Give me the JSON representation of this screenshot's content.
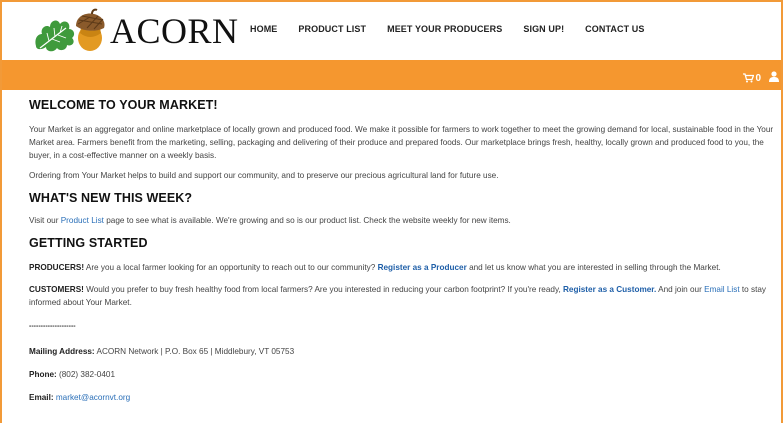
{
  "header": {
    "logo_text": "ACORN",
    "nav": [
      "HOME",
      "PRODUCT LIST",
      "MEET YOUR PRODUCERS",
      "SIGN UP!",
      "CONTACT US"
    ]
  },
  "toolbar": {
    "cart_count": "0",
    "cart_icon": "cart-icon",
    "user_icon": "user-icon"
  },
  "main": {
    "welcome_heading": "WELCOME TO YOUR MARKET!",
    "welcome_p1": "Your Market is an aggregator and online marketplace of locally grown and produced food. We make it possible for farmers to work together to meet the growing demand for local, sustainable food in the Your Market area. Farmers benefit from the marketing, selling, packaging and delivering of their produce and prepared foods. Our marketplace brings fresh, healthy, locally grown and produced food to you, the buyer, in a cost-effective manner on a weekly basis.",
    "welcome_p2": "Ordering from Your Market helps to build and support our community, and to preserve our precious agricultural land for future use.",
    "new_heading": "WHAT'S NEW THIS WEEK?",
    "new_pre": "Visit our ",
    "new_link": "Product List",
    "new_post": " page to see what is available. We're growing and so is our product list. Check the website weekly for new items.",
    "started_heading": "GETTING STARTED",
    "producers_label": "PRODUCERS!",
    "producers_pre": " Are you a local farmer looking for an opportunity to reach out to our community? ",
    "producers_link": "Register as a Producer",
    "producers_post": " and let us know what you are interested in selling through the Market.",
    "customers_label": "CUSTOMERS!",
    "customers_pre": " Would you prefer to buy fresh healthy food from local farmers? Are you interested in reducing your carbon footprint? If you're ready, ",
    "customers_link": "Register as a Customer.",
    "customers_mid": " And join our ",
    "customers_link2": "Email List",
    "customers_post": " to stay informed about Your Market.",
    "divider": "--------------------",
    "mailing_label": "Mailing Address:",
    "mailing_value": " ACORN Network | P.O. Box 65 | Middlebury, VT 05753",
    "phone_label": "Phone:",
    "phone_value": " (802) 382-0401",
    "email_label": "Email:",
    "email_link": "market@acornvt.org"
  },
  "colors": {
    "accent": "#f5972f",
    "link": "#2a6fb8",
    "logo_green": "#3f9a3c",
    "logo_brown": "#a5672a"
  }
}
